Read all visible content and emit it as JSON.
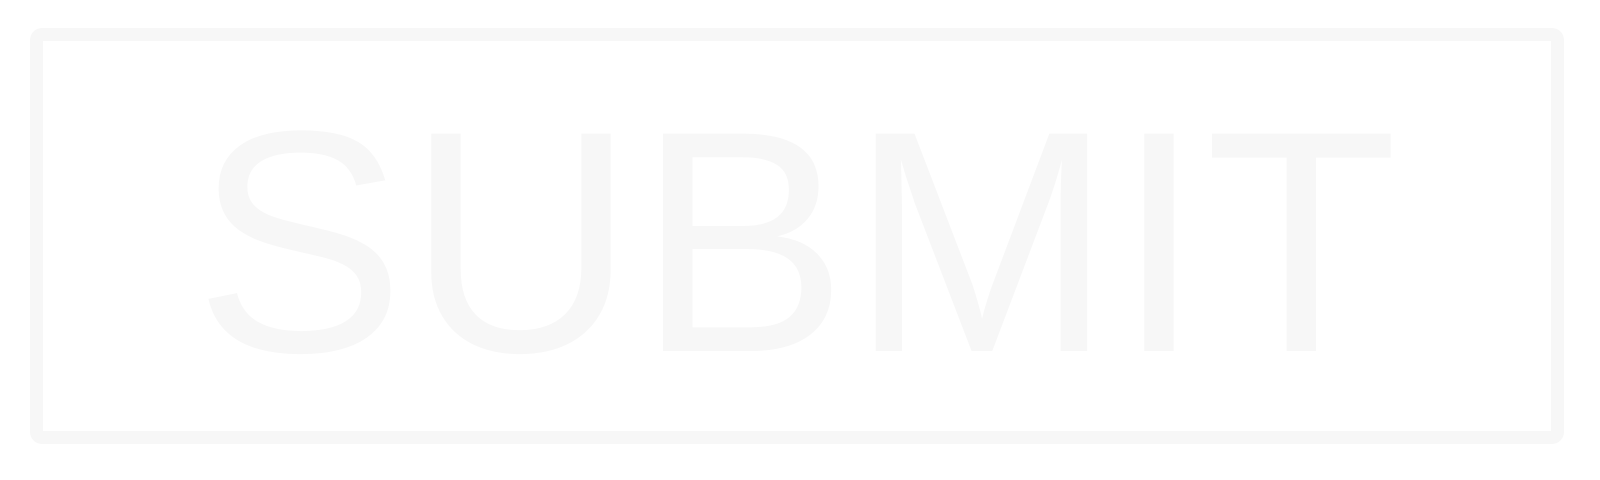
{
  "button": {
    "label": "SUBMIT"
  },
  "colors": {
    "background": "#ffffff",
    "outline": "#f7f7f7",
    "text": "#f7f7f7"
  }
}
